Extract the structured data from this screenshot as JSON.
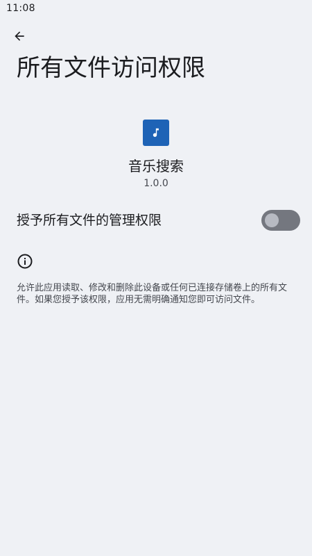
{
  "status_bar": {
    "time": "11:08"
  },
  "header": {
    "back_icon": "arrow-left-icon",
    "title": "所有文件访问权限"
  },
  "app": {
    "icon": "music-note-icon",
    "icon_color": "#1e63b6",
    "name": "音乐搜索",
    "version": "1.0.0"
  },
  "permission": {
    "label": "授予所有文件的管理权限",
    "enabled": false
  },
  "info": {
    "icon": "info-icon",
    "text": "允许此应用读取、修改和删除此设备或任何已连接存储卷上的所有文件。如果您授予该权限，应用无需明确通知您即可访问文件。"
  }
}
